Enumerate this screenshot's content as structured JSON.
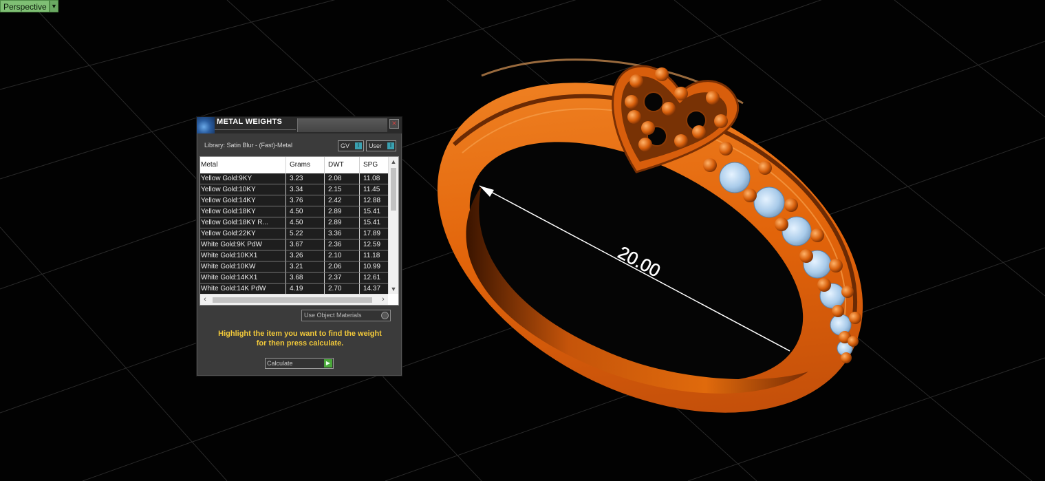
{
  "viewport": {
    "label": "Perspective",
    "dimension_value": "20.00",
    "colors": {
      "background": "#020202",
      "metal": "#e9690c",
      "gem": "#a8ccec"
    }
  },
  "dialog": {
    "title": "METAL WEIGHTS",
    "library": "Library: Satin Blur - (Fast)-Metal",
    "toggle_gv": "GV",
    "toggle_user": "User",
    "columns": [
      "Metal",
      "Grams",
      "DWT",
      "SPG"
    ],
    "rows": [
      [
        "Yellow Gold:9KY",
        "3.23",
        "2.08",
        "11.08"
      ],
      [
        "Yellow Gold:10KY",
        "3.34",
        "2.15",
        "11.45"
      ],
      [
        "Yellow Gold:14KY",
        "3.76",
        "2.42",
        "12.88"
      ],
      [
        "Yellow Gold:18KY",
        "4.50",
        "2.89",
        "15.41"
      ],
      [
        "Yellow Gold:18KY R...",
        "4.50",
        "2.89",
        "15.41"
      ],
      [
        "Yellow Gold:22KY",
        "5.22",
        "3.36",
        "17.89"
      ],
      [
        "White Gold:9K PdW",
        "3.67",
        "2.36",
        "12.59"
      ],
      [
        "White Gold:10KX1",
        "3.26",
        "2.10",
        "11.18"
      ],
      [
        "White Gold:10KW",
        "3.21",
        "2.06",
        "10.99"
      ],
      [
        "White Gold:14KX1",
        "3.68",
        "2.37",
        "12.61"
      ],
      [
        "White Gold:14K PdW",
        "4.19",
        "2.70",
        "14.37"
      ]
    ],
    "use_object_materials": "Use Object Materials",
    "instructions_line1": "Highlight the item you want to find the weight",
    "instructions_line2": "for then press calculate.",
    "calculate_label": "Calculate"
  }
}
